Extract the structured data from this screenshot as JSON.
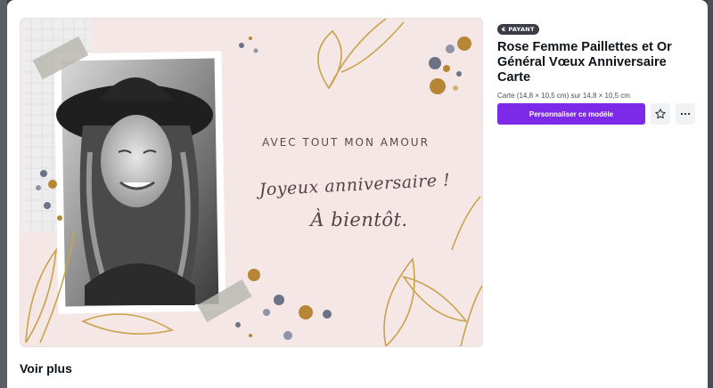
{
  "card": {
    "headline": "AVEC TOUT MON AMOUR",
    "script_line1": "Joyeux anniversaire !",
    "script_line2": "À bientôt."
  },
  "template": {
    "badge": "€ PAYANT",
    "title": "Rose Femme Paillettes et Or Général Vœux Anniversaire Carte",
    "dimensions": "Carte (14,8 × 10,5 cm) sur 14,8 × 10,5 cm",
    "primary_button": "Personnaliser ce modèle",
    "icons": {
      "favorite": "star-icon",
      "more": "more-horizontal-icon"
    }
  },
  "footer": {
    "see_more": "Voir plus"
  },
  "colors": {
    "accent": "#7d2ae8",
    "card_background": "#f4e7e6",
    "gold": "#c9a24a",
    "slate": "#6b7286"
  }
}
